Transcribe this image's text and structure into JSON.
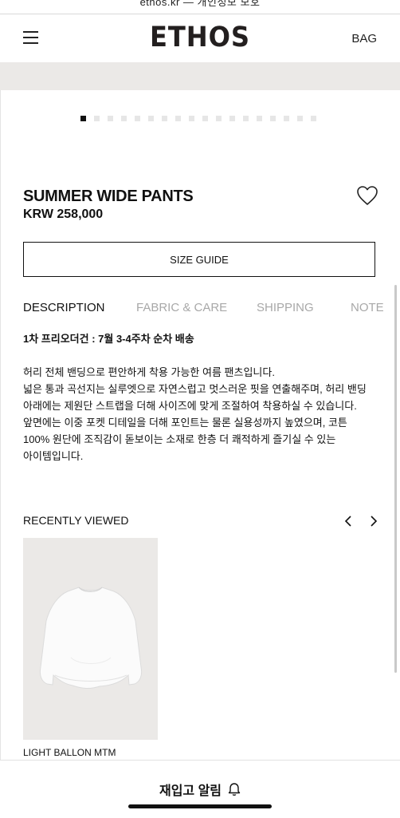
{
  "browser": {
    "url": "ethos.kr — 개인정보 보호"
  },
  "header": {
    "logo": "ETHOS",
    "bag_label": "BAG"
  },
  "gallery": {
    "dot_count": 18,
    "active_index": 0
  },
  "product": {
    "name": "SUMMER WIDE PANTS",
    "price": "KRW 258,000",
    "size_guide_label": "SIZE GUIDE"
  },
  "tabs": [
    {
      "label": "DESCRIPTION",
      "active": true
    },
    {
      "label": "FABRIC & CARE",
      "active": false
    },
    {
      "label": "SHIPPING",
      "active": false
    },
    {
      "label": "NOTE",
      "active": false
    }
  ],
  "description": {
    "notice": "1차 프리오더건 : 7월 3-4주차 순차 배송",
    "lines": [
      "허리 전체 밴딩으로 편안하게 착용 가능한 여름 팬츠입니다.",
      "넓은 통과 곡선지는 실루엣으로 자연스럽고 멋스러운 핏을 연출해주며, 허리 밴딩",
      "아래에는 제원단 스트랩을 더해 사이즈에 맞게 조절하여 착용하실 수 있습니다.",
      "앞면에는 이중 포켓 디테일을 더해 포인트는 물론 실용성까지 높였으며, 코튼",
      "100% 원단에 조직감이 돋보이는 소재로 한층 더 쾌적하게 즐기실 수 있는",
      "아이템입니다."
    ]
  },
  "recently_viewed": {
    "title": "RECENTLY VIEWED",
    "items": [
      {
        "name": "LIGHT BALLON MTM"
      }
    ]
  },
  "bottom": {
    "restock_label": "재입고 알림"
  },
  "colors": {
    "accent": "#111111",
    "inactive_tab": "#a8a8a8",
    "image_bg": "#ebe9e7"
  }
}
